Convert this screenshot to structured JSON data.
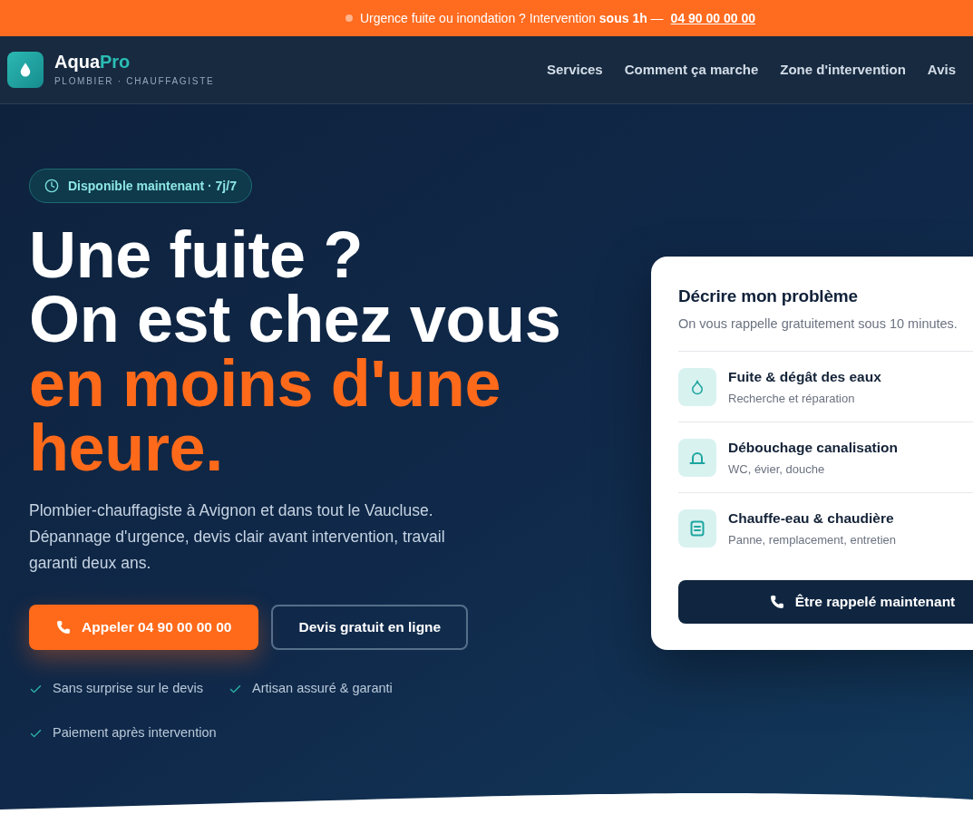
{
  "banner": {
    "message": "Urgence fuite ou inondation ? Intervention **sous 1h** —",
    "phone_link": "04 90 00 00 00"
  },
  "header": {
    "brand": {
      "name_part_1": "Aqua",
      "name_part_2": "Pro",
      "tagline": "PLOMBIER · CHAUFFAGISTE"
    },
    "nav_links": [
      "Services",
      "Comment ça marche",
      "Zone d'intervention",
      "Avis"
    ]
  },
  "hero": {
    "badge": "Disponible maintenant · 7j/7",
    "headline": {
      "line_1": "Une fuite ?",
      "line_2": "On est chez vous",
      "highlight": "en moins d'une heure."
    },
    "description": "Plombier-chauffagiste à Avignon et dans tout le Vaucluse. Dépannage d'urgence, devis clair avant intervention, travail garanti deux ans.",
    "buttons": [
      {
        "kind": "primary",
        "label": "Appeler 04 90 00 00 00"
      },
      {
        "kind": "outline",
        "label": "Devis gratuit en ligne"
      }
    ],
    "benefits": [
      "Sans surprise sur le devis",
      "Artisan assuré & garanti",
      "Paiement après intervention"
    ]
  },
  "problem_card": {
    "title": "Décrire mon problème",
    "subtitle": "On vous rappelle gratuitement sous 10 minutes.",
    "options": [
      {
        "title": "Fuite & dégât des eaux",
        "description": "Recherche et réparation"
      },
      {
        "title": "Débouchage canalisation",
        "description": "WC, évier, douche"
      },
      {
        "title": "Chauffe-eau & chaudière",
        "description": "Panne, remplacement, entretien"
      }
    ],
    "button": "Être rappelé maintenant"
  }
}
